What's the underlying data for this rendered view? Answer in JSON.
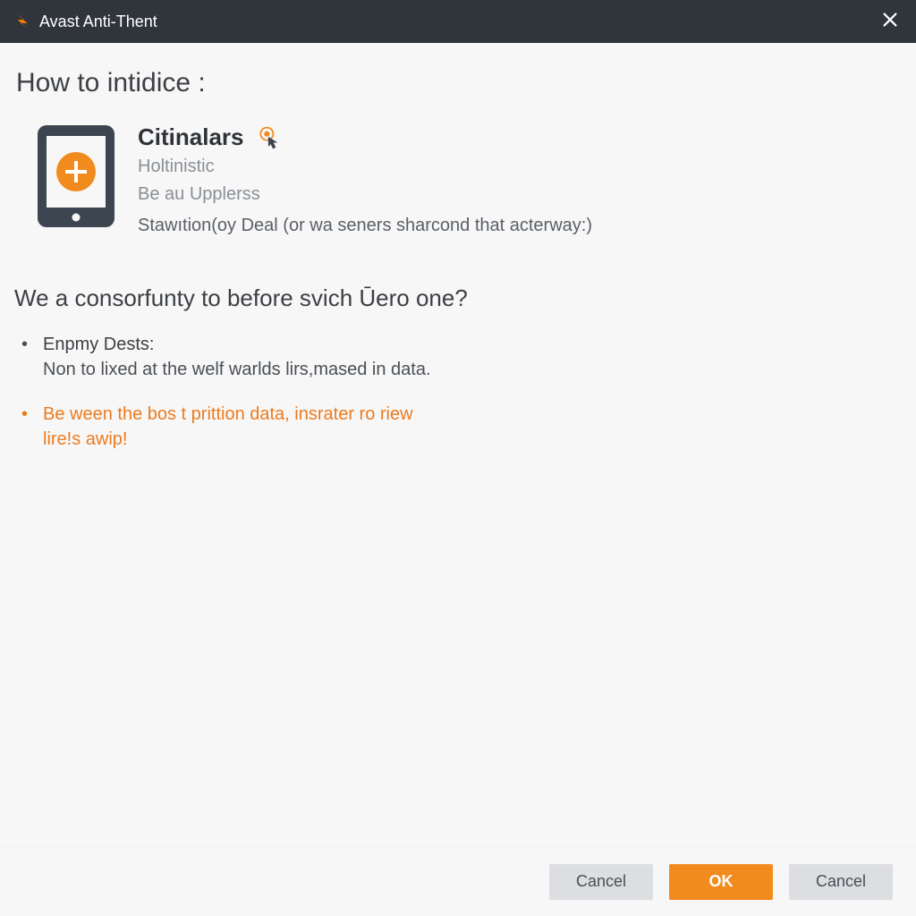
{
  "colors": {
    "accent": "#f28b1d",
    "titlebar": "#2f353b",
    "text": "#3c3f44",
    "muted": "#8a8f96"
  },
  "titlebar": {
    "app_name": "Avast Anti-Thent"
  },
  "main": {
    "page_title": "How to intidice :",
    "info": {
      "title": "Citinalars",
      "sub1": "Holtinistic",
      "sub2": "Be au Upplerss",
      "desc": "Stawıtion(oy Deal (or wa seners sharcond that acterway:)"
    },
    "section_heading": "We a consorfunty to before svich Ūero one?",
    "bullets": [
      {
        "title": "Enpmy Dests:",
        "body": "Non to lixed at the welf warlds lirs,mased in data.",
        "style": "dark"
      },
      {
        "body": "Be ween the bos t prittion data, insrater ro riew lire!s awip!",
        "style": "orange"
      }
    ]
  },
  "footer": {
    "cancel1_label": "Cancel",
    "ok_label": "OK",
    "cancel2_label": "Cancel"
  }
}
